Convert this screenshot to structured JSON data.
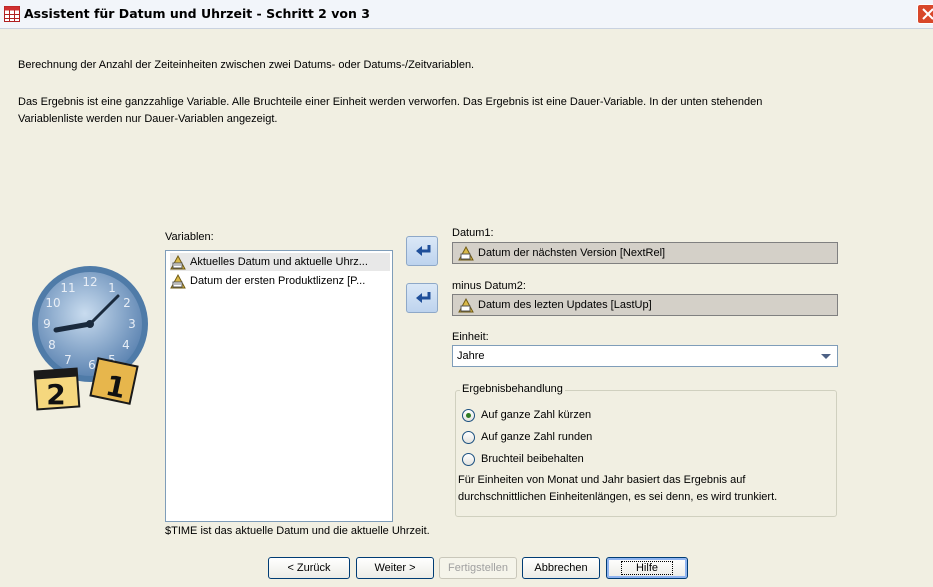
{
  "window": {
    "title": "Assistent für Datum und Uhrzeit - Schritt 2 von 3",
    "icon": "table-grid-icon",
    "close_icon": "close-icon"
  },
  "description": {
    "line1": "Berechnung der Anzahl der Zeiteinheiten zwischen zwei Datums- oder Datums-/Zeitvariablen.",
    "line2": "Das Ergebnis ist eine ganzzahlige Variable. Alle Bruchteile einer Einheit werden verworfen. Das Ergebnis ist eine Dauer-Variable. In der unten stehenden",
    "line3": "Variablenliste werden nur Dauer-Variablen angezeigt."
  },
  "variables": {
    "label": "Variablen:",
    "items": [
      {
        "label": "Aktuelles Datum und aktuelle Uhrz...",
        "icon": "date-variable-icon",
        "selected": true
      },
      {
        "label": "Datum der ersten Produktlizenz [P...",
        "icon": "date-variable-icon",
        "selected": false
      }
    ],
    "footnote": "$TIME ist das aktuelle Datum und die aktuelle Uhrzeit."
  },
  "date1": {
    "label": "Datum1:",
    "value": "Datum der nächsten Version [NextRel]"
  },
  "date2": {
    "label": "minus Datum2:",
    "value": "Datum des lezten Updates [LastUp]"
  },
  "unit": {
    "label": "Einheit:",
    "value": "Jahre"
  },
  "result": {
    "title": "Ergebnisbehandlung",
    "options": [
      {
        "label": "Auf ganze Zahl kürzen",
        "checked": true
      },
      {
        "label": "Auf ganze Zahl runden",
        "checked": false
      },
      {
        "label": "Bruchteil beibehalten",
        "checked": false
      }
    ],
    "note_line1": "Für Einheiten von Monat und Jahr basiert das Ergebnis auf",
    "note_line2": "durchschnittlichen Einheitenlängen, es sei denn, es wird trunkiert."
  },
  "buttons": {
    "back": "< Zurück",
    "next": "Weiter >",
    "finish": "Fertigstellen",
    "cancel": "Abbrechen",
    "help": "Hilfe"
  },
  "illustration": {
    "clock_numbers": [
      "12",
      "1",
      "2",
      "3",
      "4",
      "5",
      "6",
      "7",
      "8",
      "9",
      "10",
      "11"
    ],
    "calendar_left": "2",
    "calendar_right": "1"
  }
}
